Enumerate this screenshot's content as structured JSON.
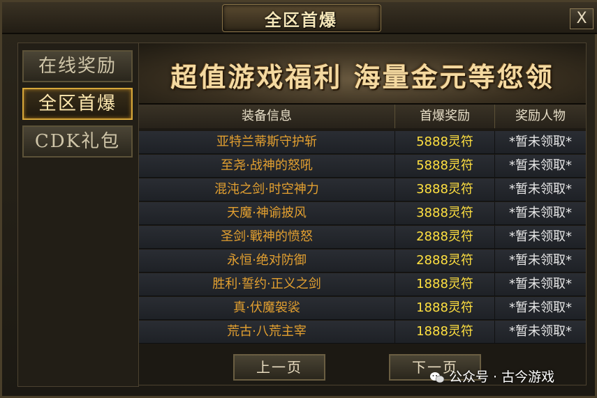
{
  "window": {
    "title": "全区首爆",
    "close_label": "X"
  },
  "sidebar": {
    "items": [
      {
        "label": "在线奖励",
        "active": false
      },
      {
        "label": "全区首爆",
        "active": true
      },
      {
        "label": "CDK礼包",
        "active": false
      }
    ]
  },
  "banner": {
    "text": "超值游戏福利  海量金元等您领"
  },
  "table": {
    "headers": [
      "装备信息",
      "首爆奖励",
      "奖励人物"
    ],
    "rows": [
      [
        "亚特兰蒂斯守护斩",
        "5888灵符",
        "*暂未领取*"
      ],
      [
        "至尧·战神的怒吼",
        "5888灵符",
        "*暂未领取*"
      ],
      [
        "混沌之剑·时空神力",
        "3888灵符",
        "*暂未领取*"
      ],
      [
        "天魔·神谕披风",
        "3888灵符",
        "*暂未领取*"
      ],
      [
        "圣剑·戰神的愤怒",
        "2888灵符",
        "*暂未领取*"
      ],
      [
        "永恒·绝对防御",
        "2888灵符",
        "*暂未领取*"
      ],
      [
        "胜利·誓约·正义之剑",
        "1888灵符",
        "*暂未领取*"
      ],
      [
        "真·伏魔袈裟",
        "1888灵符",
        "*暂未领取*"
      ],
      [
        "荒古·八荒主宰",
        "1888灵符",
        "*暂未领取*"
      ]
    ]
  },
  "pager": {
    "prev_label": "上一页",
    "next_label": "下一页"
  },
  "watermark": {
    "text": "公众号 · 古今游戏",
    "icon": "wechat-icon"
  },
  "colors": {
    "item_name": "#e3a030",
    "reward": "#ffe040",
    "status": "#e6e6e6",
    "active_border": "#d8a83a"
  }
}
